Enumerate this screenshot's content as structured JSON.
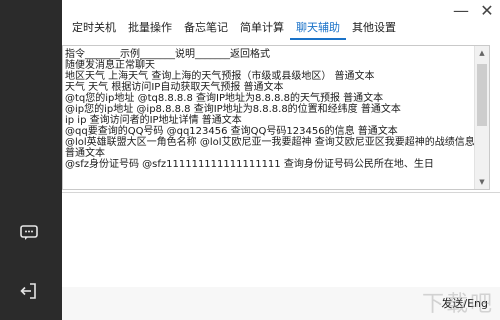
{
  "sidebar": {
    "chat_icon": "chat-bubble-icon",
    "logout_icon": "logout-icon"
  },
  "window": {
    "minimize": "—",
    "close": "✕"
  },
  "tabs": [
    {
      "label": "定时关机"
    },
    {
      "label": "批量操作"
    },
    {
      "label": "备忘笔记"
    },
    {
      "label": "简单计算"
    },
    {
      "label": "聊天辅助",
      "active": true
    },
    {
      "label": "其他设置"
    }
  ],
  "content": {
    "lines": [
      "指令_______示例_______说明_______返回格式",
      "随便发消息正常聊天",
      "地区天气 上海天气 查询上海的天气预报（市级或县级地区） 普通文本",
      "天气 天气 根据访问IP自动获取天气预报 普通文本",
      "@tq您的ip地址 @tq8.8.8.8 查询IP地址为8.8.8.8的天气预报 普通文本",
      "@ip您的ip地址 @ip8.8.8.8 查询IP地址为8.8.8.8的位置和经纬度 普通文本",
      "ip ip 查询访问者的IP地址详情 普通文本",
      "@qq要查询的QQ号码 @qq123456 查询QQ号码123456的信息 普通文本",
      "@lol英雄联盟大区一角色名称 @lol艾欧尼亚一我要超神 查询艾欧尼亚区我要超神的战绩信息 普通文本",
      "@sfz身份证号码 @sfz111111111111111111 查询身份证号码公民所在地、生日"
    ]
  },
  "send_label": "发送/Eng",
  "watermark": "下载吧",
  "colors": {
    "sidebar": "#2b2b2b",
    "accent": "#1a72c8"
  }
}
